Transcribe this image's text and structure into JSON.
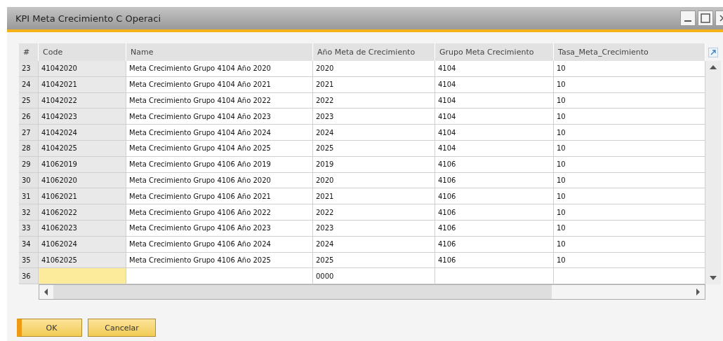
{
  "window": {
    "title": "KPI Meta Crecimiento C Operaci"
  },
  "table": {
    "columns": [
      "#",
      "Code",
      "Name",
      "Año Meta de Crecimiento",
      "Grupo Meta Crecimiento",
      "Tasa_Meta_Crecimiento"
    ],
    "rows": [
      {
        "cells": [
          "23",
          "41042020",
          "Meta Crecimiento Grupo 4104 Año 2020",
          "2020",
          "4104",
          "10"
        ],
        "selected": false
      },
      {
        "cells": [
          "24",
          "41042021",
          "Meta Crecimiento Grupo 4104 Año 2021",
          "2021",
          "4104",
          "10"
        ],
        "selected": false
      },
      {
        "cells": [
          "25",
          "41042022",
          "Meta Crecimiento Grupo 4104 Año 2022",
          "2022",
          "4104",
          "10"
        ],
        "selected": false
      },
      {
        "cells": [
          "26",
          "41042023",
          "Meta Crecimiento Grupo 4104 Año 2023",
          "2023",
          "4104",
          "10"
        ],
        "selected": false
      },
      {
        "cells": [
          "27",
          "41042024",
          "Meta Crecimiento Grupo 4104 Año 2024",
          "2024",
          "4104",
          "10"
        ],
        "selected": false
      },
      {
        "cells": [
          "28",
          "41042025",
          "Meta Crecimiento Grupo 4104 Año 2025",
          "2025",
          "4104",
          "10"
        ],
        "selected": false
      },
      {
        "cells": [
          "29",
          "41062019",
          "Meta Crecimiento Grupo 4106 Año 2019",
          "2019",
          "4106",
          "10"
        ],
        "selected": false
      },
      {
        "cells": [
          "30",
          "41062020",
          "Meta Crecimiento Grupo 4106 Año 2020",
          "2020",
          "4106",
          "10"
        ],
        "selected": false
      },
      {
        "cells": [
          "31",
          "41062021",
          "Meta Crecimiento Grupo 4106 Año 2021",
          "2021",
          "4106",
          "10"
        ],
        "selected": false
      },
      {
        "cells": [
          "32",
          "41062022",
          "Meta Crecimiento Grupo 4106 Año 2022",
          "2022",
          "4106",
          "10"
        ],
        "selected": false
      },
      {
        "cells": [
          "33",
          "41062023",
          "Meta Crecimiento Grupo 4106 Año 2023",
          "2023",
          "4106",
          "10"
        ],
        "selected": false
      },
      {
        "cells": [
          "34",
          "41062024",
          "Meta Crecimiento Grupo 4106 Año 2024",
          "2024",
          "4106",
          "10"
        ],
        "selected": false
      },
      {
        "cells": [
          "35",
          "41062025",
          "Meta Crecimiento Grupo 4106 Año 2025",
          "2025",
          "4106",
          "10"
        ],
        "selected": false
      },
      {
        "cells": [
          "36",
          "",
          "",
          "0000",
          "",
          ""
        ],
        "selected": true
      }
    ]
  },
  "buttons": [
    {
      "label": "OK",
      "kind": "primary"
    },
    {
      "label": "Cancelar",
      "kind": "secondary"
    }
  ]
}
